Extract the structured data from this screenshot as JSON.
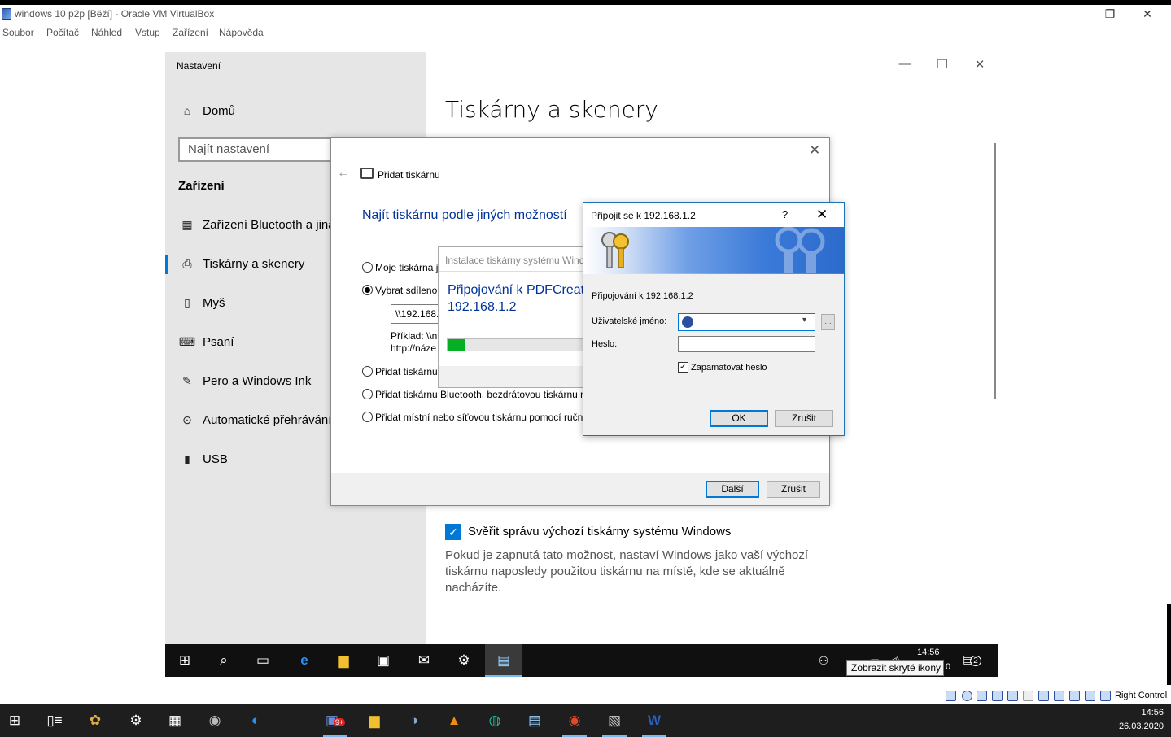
{
  "vbox": {
    "title": "windows 10 p2p [Běží] - Oracle VM VirtualBox",
    "controls": {
      "minimize": "—",
      "restore": "❐",
      "close": "✕"
    },
    "menu": [
      "Soubor",
      "Počítač",
      "Náhled",
      "Vstup",
      "Zařízení",
      "Nápověda"
    ],
    "status_right": "Right Control"
  },
  "settings": {
    "window_title": "Nastavení",
    "home_label": "Domů",
    "search_placeholder": "Najít nastavení",
    "group_title": "Zařízení",
    "nav": [
      {
        "label": "Zařízení Bluetooth a jiná",
        "icon": "bluetooth-devices-icon"
      },
      {
        "label": "Tiskárny a skenery",
        "icon": "printer-icon"
      },
      {
        "label": "Myš",
        "icon": "mouse-icon"
      },
      {
        "label": "Psaní",
        "icon": "keyboard-icon"
      },
      {
        "label": "Pero a Windows Ink",
        "icon": "pen-icon"
      },
      {
        "label": "Automatické přehrávání",
        "icon": "autoplay-icon"
      },
      {
        "label": "USB",
        "icon": "usb-icon"
      }
    ],
    "page_title": "Tiskárny a skenery",
    "default_printer_check_label": "Svěřit správu výchozí tiskárny systému Windows",
    "default_printer_desc": "Pokud je zapnutá tato možnost, nastaví Windows jako vaší výchozí tiskárnu naposledy použitou tiskárnu na místě, kde se aktuálně nacházíte."
  },
  "add_printer": {
    "title": "Přidat tiskárnu",
    "heading": "Najít tiskárnu podle jiných možností",
    "options": [
      "Moje tiskárna j",
      "Vybrat sdílenou",
      "Přidat tiskárnu",
      "Přidat tiskárnu Bluetooth, bezdrátovou tiskárnu n",
      "Přidat místní nebo síťovou tiskárnu pomocí ruční"
    ],
    "share_value": "\\\\192.168.",
    "example_line1": "Příklad: \\\\n",
    "example_line2": "http://náze",
    "next_label": "Další",
    "cancel_label": "Zrušit"
  },
  "install": {
    "title": "Instalace tiskárny systému Wind",
    "message_line1": "Připojování k PDFCreato",
    "message_line2": "192.168.1.2",
    "progress": 0.13
  },
  "credentials": {
    "title": "Připojit se k 192.168.1.2",
    "help": "?",
    "subtitle": "Připojování k 192.168.1.2",
    "username_label": "Uživatelské jméno:",
    "password_label": "Heslo:",
    "remember_label": "Zapamatovat heslo",
    "remember_checked": true,
    "more_button": "...",
    "ok_label": "OK",
    "cancel_label": "Zrušit"
  },
  "guest_taskbar": {
    "time": "14:56",
    "tooltip": "Zobrazit skryté ikony",
    "tooltip_tail": "0",
    "notification_count": "2"
  },
  "host_taskbar": {
    "time": "14:56",
    "date": "26.03.2020",
    "badge": "9+"
  },
  "colors": {
    "accent": "#0078d7",
    "progress": "#06b025",
    "link": "#003399"
  }
}
